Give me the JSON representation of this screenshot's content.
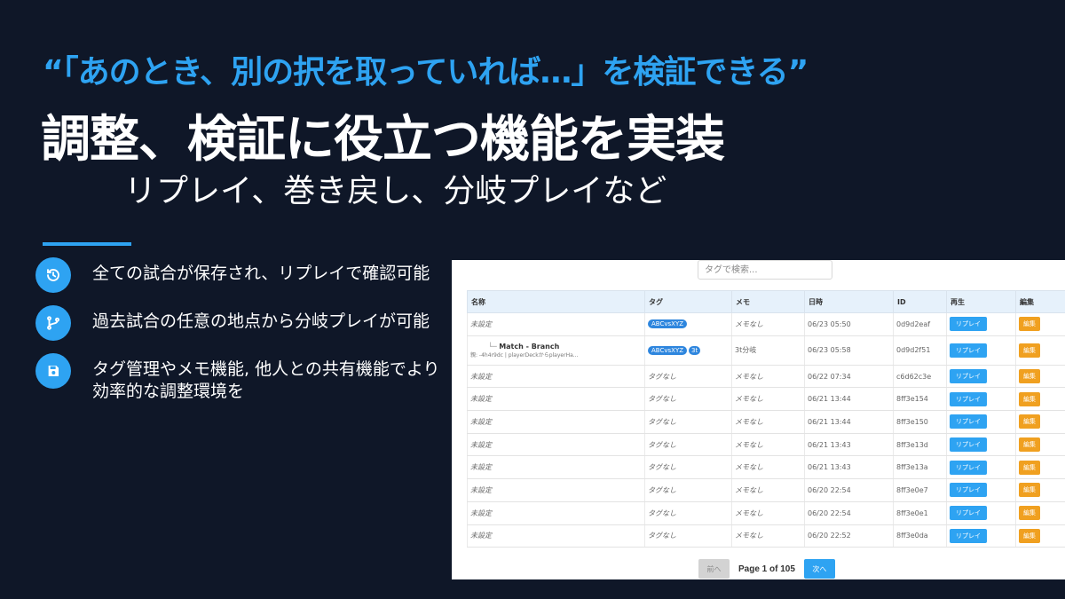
{
  "slide": {
    "quote": "“「あのとき、別の択を取っていれば…」を検証できる”",
    "title": "調整、検証に役立つ機能を実装",
    "subtitle": "リプレイ、巻き戻し、分岐プレイなど",
    "accent_color": "#2ea3f2",
    "features": [
      {
        "icon": "history-icon",
        "text": "全ての試合が保存され、リプレイで確認可能"
      },
      {
        "icon": "branch-icon",
        "text": "過去試合の任意の地点から分岐プレイが可能"
      },
      {
        "icon": "save-icon",
        "text": "タグ管理やメモ機能, 他人との共有機能でより効率的な調整環境を"
      }
    ]
  },
  "app": {
    "search": {
      "placeholder": "タグで検索..."
    },
    "columns": [
      "名称",
      "タグ",
      "メモ",
      "日時",
      "ID",
      "再生",
      "編集"
    ],
    "replay_label": "リプレイ",
    "edit_label": "編集",
    "rows": [
      {
        "name": "未設定",
        "tag": "ABCvsXYZ",
        "tag_count": "",
        "memo": "メモなし",
        "date": "06/23 05:50",
        "id": "0d9d2eaf"
      },
      {
        "name": "Match - Branch",
        "branch_sub": "親: -4h4r9dc | playerDeckからplayerHa...",
        "tag": "ABCvsXYZ",
        "tag_count": "3t",
        "memo": "3t分岐",
        "date": "06/23 05:58",
        "id": "0d9d2f51"
      },
      {
        "name": "未設定",
        "tag": "タグなし",
        "tag_count": "",
        "memo": "メモなし",
        "date": "06/22 07:34",
        "id": "c6d62c3e"
      },
      {
        "name": "未設定",
        "tag": "タグなし",
        "tag_count": "",
        "memo": "メモなし",
        "date": "06/21 13:44",
        "id": "8ff3e154"
      },
      {
        "name": "未設定",
        "tag": "タグなし",
        "tag_count": "",
        "memo": "メモなし",
        "date": "06/21 13:44",
        "id": "8ff3e150"
      },
      {
        "name": "未設定",
        "tag": "タグなし",
        "tag_count": "",
        "memo": "メモなし",
        "date": "06/21 13:43",
        "id": "8ff3e13d"
      },
      {
        "name": "未設定",
        "tag": "タグなし",
        "tag_count": "",
        "memo": "メモなし",
        "date": "06/21 13:43",
        "id": "8ff3e13a"
      },
      {
        "name": "未設定",
        "tag": "タグなし",
        "tag_count": "",
        "memo": "メモなし",
        "date": "06/20 22:54",
        "id": "8ff3e0e7"
      },
      {
        "name": "未設定",
        "tag": "タグなし",
        "tag_count": "",
        "memo": "メモなし",
        "date": "06/20 22:54",
        "id": "8ff3e0e1"
      },
      {
        "name": "未設定",
        "tag": "タグなし",
        "tag_count": "",
        "memo": "メモなし",
        "date": "06/20 22:52",
        "id": "8ff3e0da"
      }
    ],
    "pager": {
      "prev": "前へ",
      "info": "Page 1 of 105",
      "next": "次へ"
    }
  }
}
